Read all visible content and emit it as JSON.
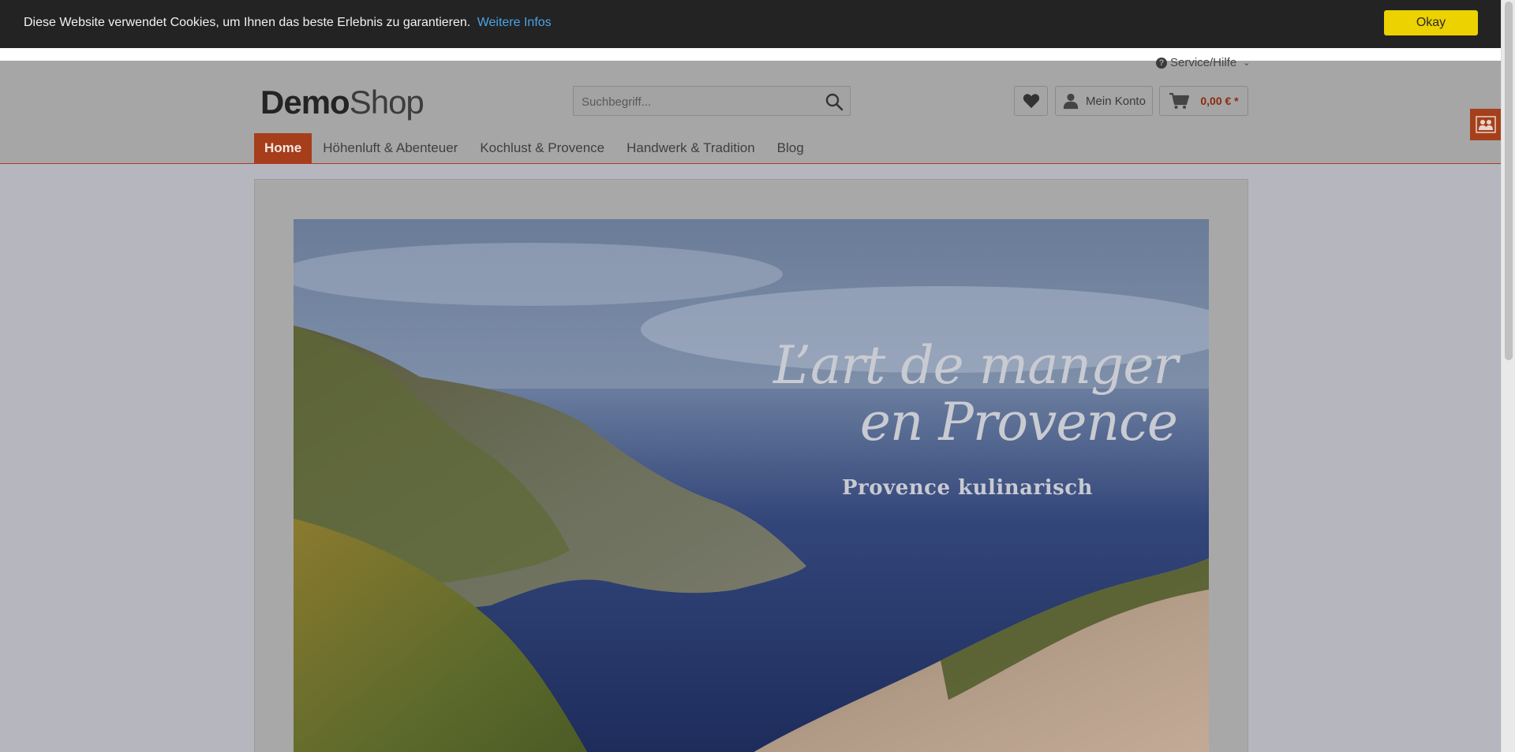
{
  "cookie": {
    "message": "Diese Website verwendet Cookies, um Ihnen das beste Erlebnis zu garantieren.",
    "more_link": "Weitere Infos",
    "ok_label": "Okay"
  },
  "header": {
    "service_label": "Service/Hilfe",
    "logo_demo": "Demo",
    "logo_shop": "Shop",
    "search_placeholder": "Suchbegriff...",
    "account_label": "Mein Konto",
    "cart_amount": "0,00 € *"
  },
  "nav": {
    "items": [
      {
        "label": "Home",
        "active": true
      },
      {
        "label": "Höhenluft & Abenteuer",
        "active": false
      },
      {
        "label": "Kochlust & Provence",
        "active": false
      },
      {
        "label": "Handwerk & Tradition",
        "active": false
      },
      {
        "label": "Blog",
        "active": false
      }
    ]
  },
  "banner": {
    "title_line1": "L’art de manger",
    "title_line2": "en Provence",
    "subtitle": "Provence kulinarisch"
  },
  "colors": {
    "accent": "#a63d1b",
    "cookie_bar": "#232323",
    "ok_button": "#ecd200",
    "link": "#4aa3e8"
  }
}
